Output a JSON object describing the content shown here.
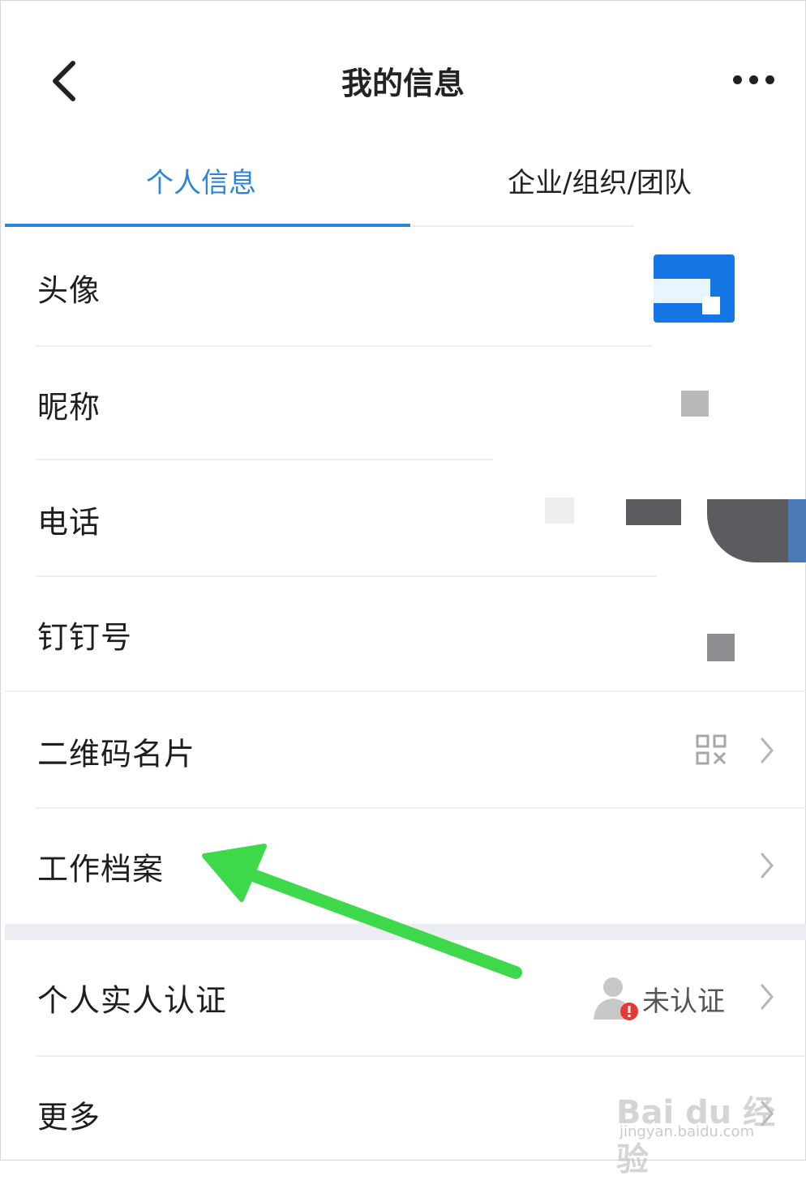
{
  "header": {
    "title": "我的信息",
    "back_icon": "chevron-left-icon",
    "more_icon": "more-dots-icon"
  },
  "tabs": [
    {
      "label": "个人信息",
      "active": true
    },
    {
      "label": "企业/组织/团队",
      "active": false
    }
  ],
  "rows": {
    "avatar": {
      "label": "头像"
    },
    "nickname": {
      "label": "昵称"
    },
    "phone": {
      "label": "电话"
    },
    "dingtalk_id": {
      "label": "钉钉号"
    },
    "qr_card": {
      "label": "二维码名片",
      "icon": "qr-code-icon"
    },
    "work_file": {
      "label": "工作档案"
    },
    "real_name": {
      "label": "个人实人认证",
      "status": "未认证",
      "icon": "unverified-person-icon"
    },
    "more": {
      "label": "更多"
    }
  },
  "watermark": {
    "logo": "Bai du 经验",
    "sub": "jingyan.baidu.com"
  },
  "colors": {
    "accent": "#2a86d8",
    "annotation_arrow": "#3ed94a",
    "badge": "#e53935"
  }
}
